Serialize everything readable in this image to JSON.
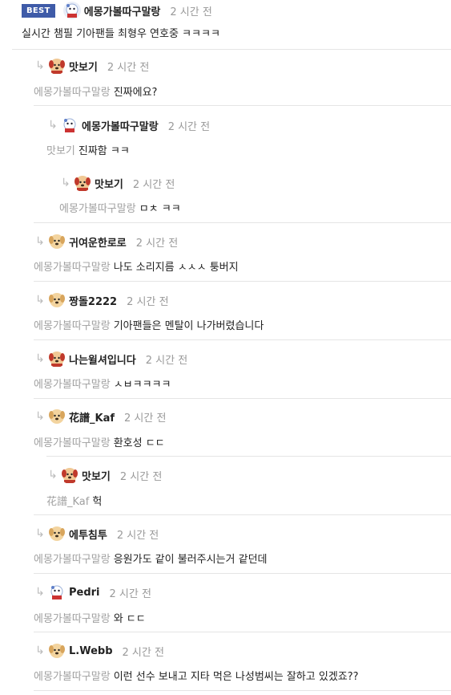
{
  "best": {
    "badge": "BEST",
    "nick": "에몽가볼따구말랑",
    "time": "2 시간 전",
    "text": "실시간 챔필 기아팬들 최형우 연호중 ㅋㅋㅋㅋ"
  },
  "replies": [
    {
      "nick": "맛보기",
      "time": "2 시간 전",
      "mention": "에몽가볼따구말랑",
      "text": "진짜에요?",
      "avatar": "red-dog-avatar"
    },
    {
      "nick": "에몽가볼따구말랑",
      "time": "2 시간 전",
      "mention": "맛보기",
      "text": "진짜함 ㅋㅋ",
      "avatar": "hero-avatar"
    },
    {
      "nick": "맛보기",
      "time": "2 시간 전",
      "mention": "에몽가볼따구말랑",
      "text": "ㅁㅊ ㅋㅋ",
      "avatar": "red-dog-avatar"
    },
    {
      "nick": "귀여운한로로",
      "time": "2 시간 전",
      "mention": "에몽가볼따구말랑",
      "text": "나도 소리지름 ㅅㅅㅅ 퉁버지",
      "avatar": "dog-avatar"
    },
    {
      "nick": "짱돌2222",
      "time": "2 시간 전",
      "mention": "에몽가볼따구말랑",
      "text": "기아팬들은 멘탈이 나가버렸습니다",
      "avatar": "dog-avatar"
    },
    {
      "nick": "나는윌셔입니다",
      "time": "2 시간 전",
      "mention": "에몽가볼따구말랑",
      "text": "ㅅㅂㅋㅋㅋㅋ",
      "avatar": "red-dog-avatar"
    },
    {
      "nick": "花譜_Kaf",
      "time": "2 시간 전",
      "mention": "에몽가볼따구말랑",
      "text": "환호성 ㄷㄷ",
      "avatar": "dog-avatar"
    },
    {
      "nick": "맛보기",
      "time": "2 시간 전",
      "mention": "花譜_Kaf",
      "text": "헉",
      "avatar": "red-dog-avatar"
    },
    {
      "nick": "에투침투",
      "time": "2 시간 전",
      "mention": "에몽가볼따구말랑",
      "text": "응원가도 같이 불러주시는거 같던데",
      "avatar": "dog-avatar"
    },
    {
      "nick": "Pedri",
      "time": "2 시간 전",
      "mention": "에몽가볼따구말랑",
      "text": "와 ㄷㄷ",
      "avatar": "hero-avatar"
    },
    {
      "nick": "L.Webb",
      "time": "2 시간 전",
      "mention": "에몽가볼따구말랑",
      "text": "이런 선수 보내고 지타 먹은 나성범씨는 잘하고 있겠죠??",
      "avatar": "dog-avatar"
    }
  ]
}
